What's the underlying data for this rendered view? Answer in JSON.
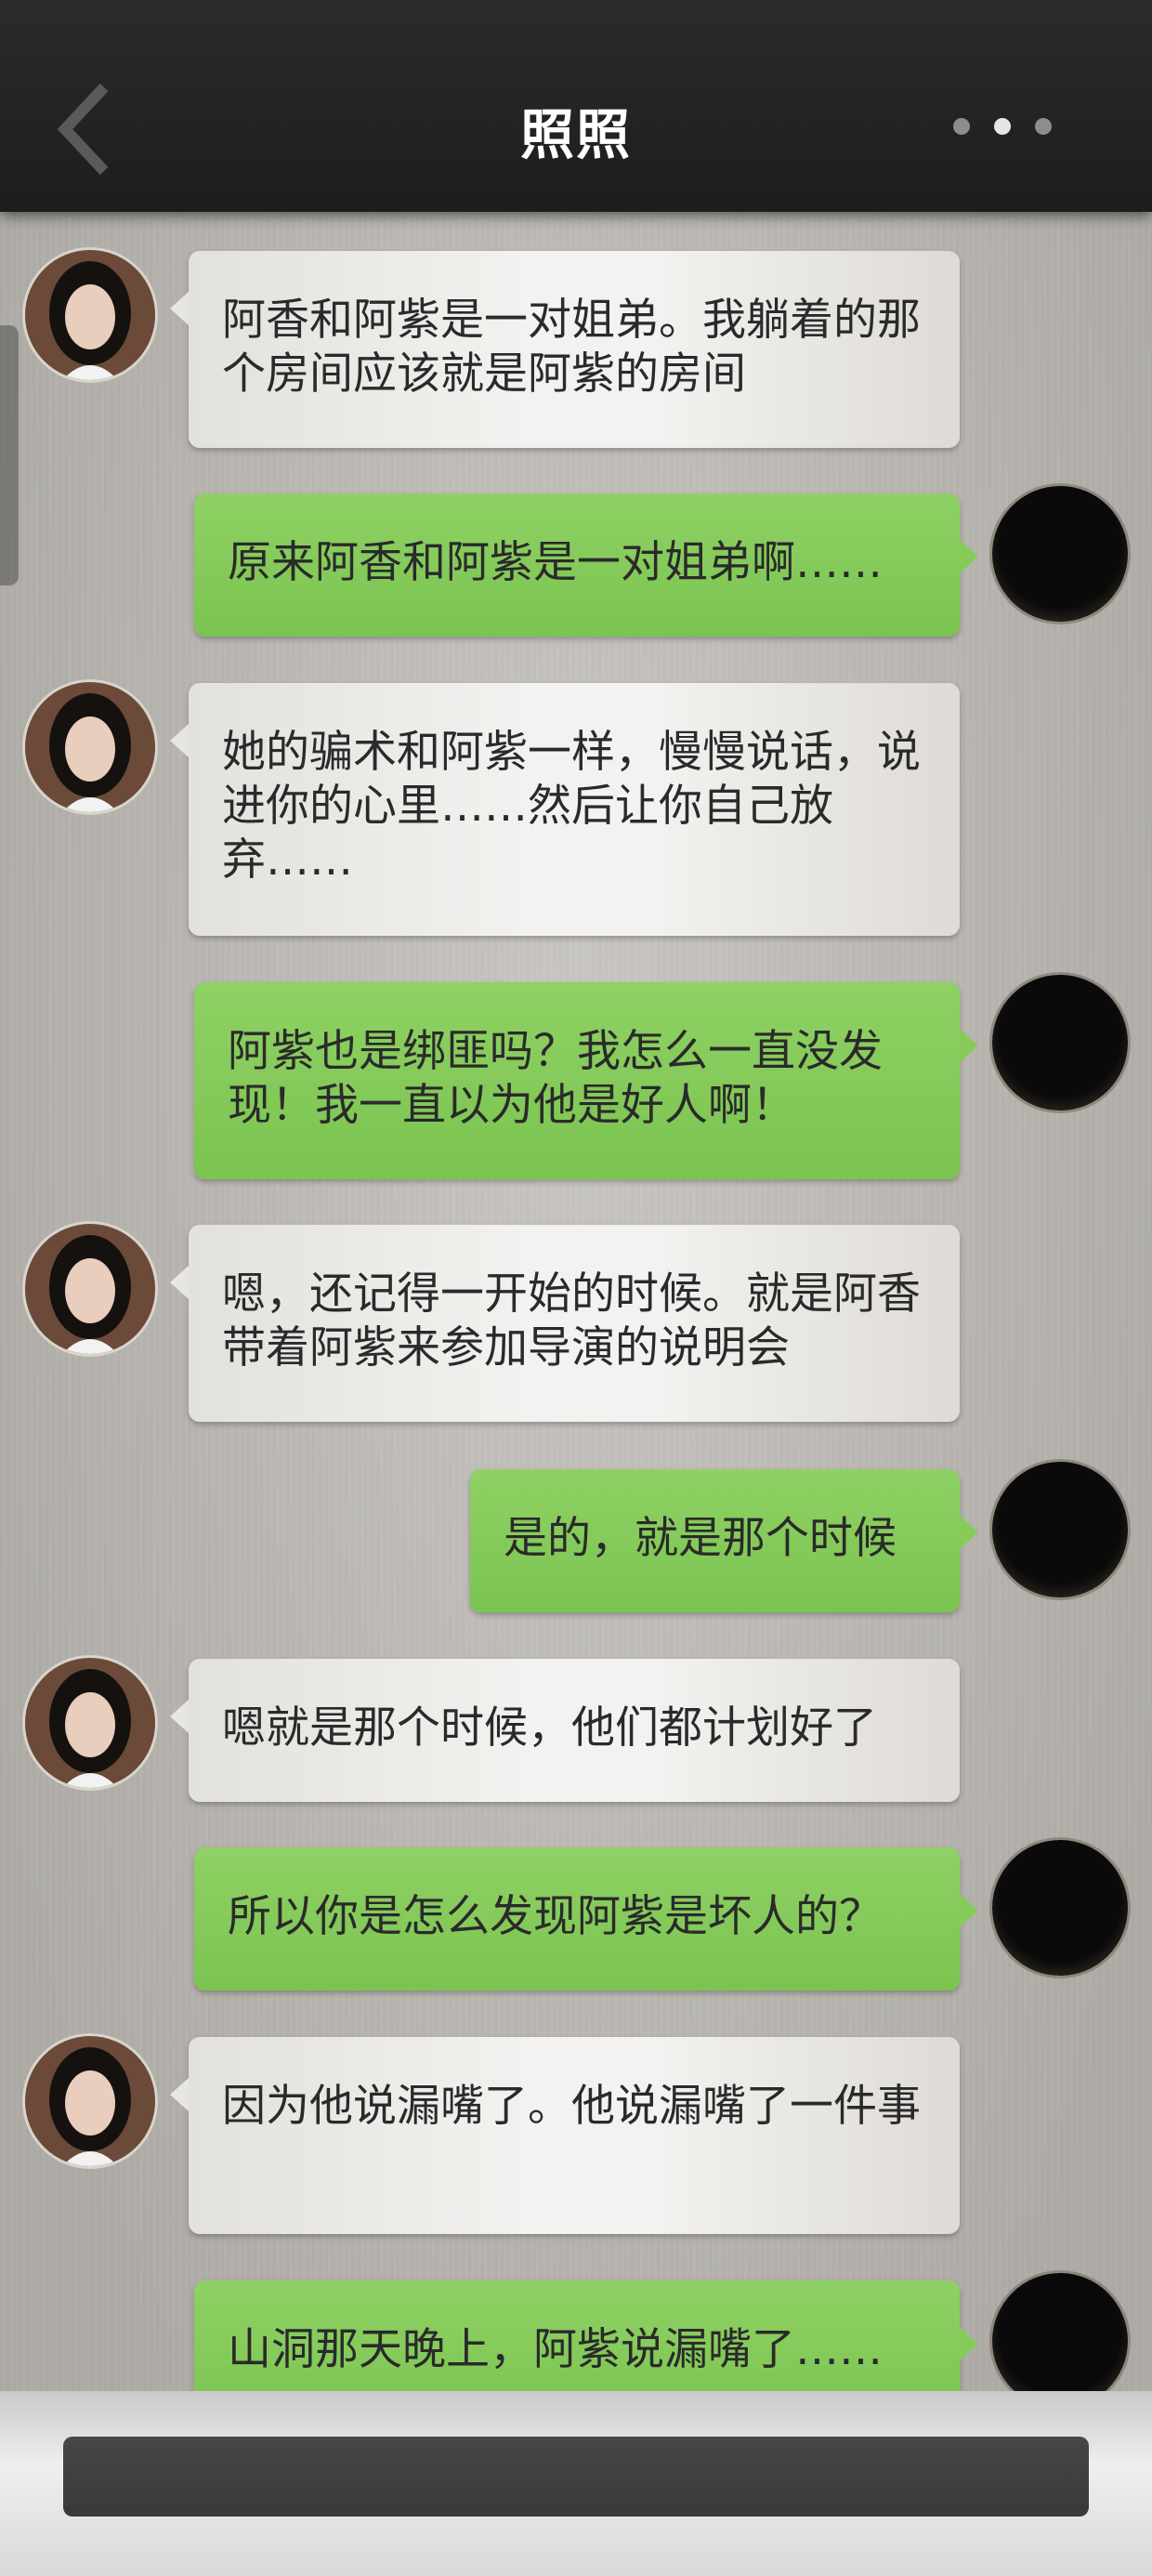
{
  "header": {
    "title": "照照",
    "back_icon": "chevron-left-icon",
    "more_icon": "more-dots-icon"
  },
  "colors": {
    "header_bg": "#222222",
    "bubble_received": "#f0efed",
    "bubble_sent": "#84c95a",
    "page_bg": "#bdbab4"
  },
  "messages": [
    {
      "side": "left",
      "text": "阿香和阿紫是一对姐弟。我躺着的那个房间应该就是阿紫的房间"
    },
    {
      "side": "right",
      "text": "原来阿香和阿紫是一对姐弟啊……"
    },
    {
      "side": "left",
      "text": "她的骗术和阿紫一样，慢慢说话，说进你的心里……然后让你自己放弃……"
    },
    {
      "side": "right",
      "text": "阿紫也是绑匪吗？我怎么一直没发现！我一直以为他是好人啊！"
    },
    {
      "side": "left",
      "text": "嗯，还记得一开始的时候。就是阿香带着阿紫来参加导演的说明会"
    },
    {
      "side": "right",
      "text": "是的，就是那个时候"
    },
    {
      "side": "left",
      "text": "嗯就是那个时候，他们都计划好了"
    },
    {
      "side": "right",
      "text": "所以你是怎么发现阿紫是坏人的？"
    },
    {
      "side": "left",
      "text": "因为他说漏嘴了。他说漏嘴了一件事"
    },
    {
      "side": "right",
      "text": "山洞那天晚上，阿紫说漏嘴了……"
    }
  ],
  "input": {
    "value": "",
    "placeholder": ""
  }
}
